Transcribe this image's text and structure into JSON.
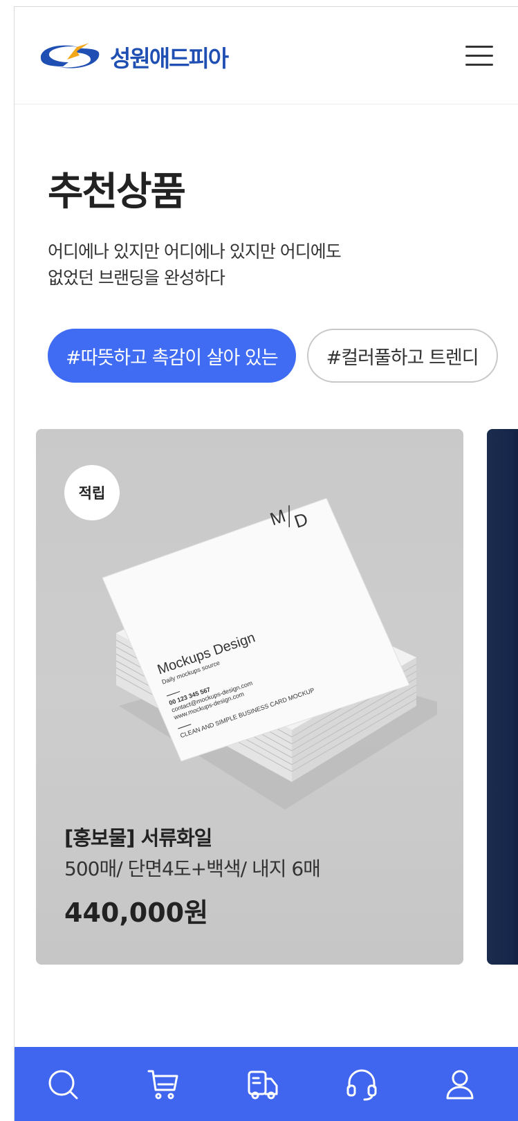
{
  "header": {
    "brand_name": "성원애드피아",
    "logo_icon": "swoosh-logo",
    "menu_icon": "hamburger-menu-icon"
  },
  "section": {
    "title": "추천상품",
    "description_line1": "어디에나 있지만 어디에나 있지만 어디에도",
    "description_line2": "없었던 브랜딩을 완성하다"
  },
  "tags": [
    {
      "label": "#따뜻하고 촉감이 살아 있는",
      "active": true
    },
    {
      "label": "#컬러풀하고 트렌디",
      "active": false
    }
  ],
  "products": [
    {
      "badge": "적립",
      "image_card": {
        "monogram_left": "M",
        "monogram_right": "D",
        "brand": "Mockups Design",
        "tagline": "Daily mockups source",
        "phone": "00 123 345 567",
        "email": "contact@mockups-design.com",
        "website": "www.mockups-design.com",
        "footer": "CLEAN AND SIMPLE BUSINESS CARD MOCKUP"
      },
      "name": "[홍보물] 서류화일",
      "spec": "500매/ 단면4도+백색/ 내지 6매",
      "price": "440,000원"
    }
  ],
  "bottom_nav": [
    {
      "icon": "search-icon"
    },
    {
      "icon": "cart-icon"
    },
    {
      "icon": "delivery-truck-icon"
    },
    {
      "icon": "headset-icon"
    },
    {
      "icon": "user-icon"
    }
  ],
  "colors": {
    "accent": "#3f6cf2",
    "nav_bg": "#4065ee",
    "logo_blue": "#1f4fb3",
    "logo_orange": "#f2a71b"
  }
}
